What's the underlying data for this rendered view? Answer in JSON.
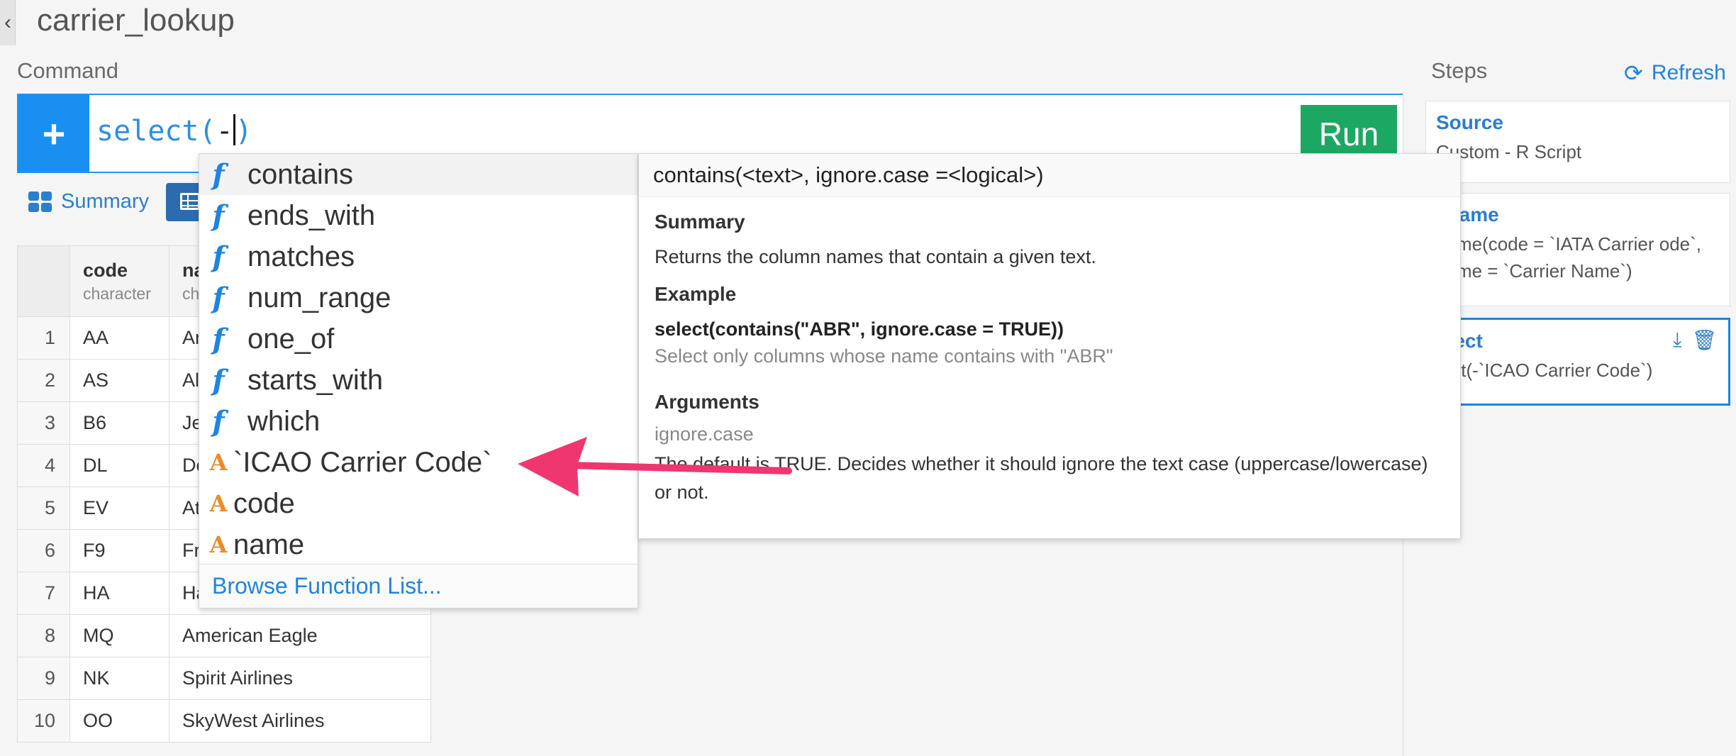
{
  "header": {
    "title": "carrier_lookup",
    "back_icon": "chevron-left-icon"
  },
  "command": {
    "label": "Command",
    "prefix": "select(",
    "typed": "-",
    "suffix": ")",
    "run_label": "Run",
    "add_icon": "plus-icon"
  },
  "view": {
    "summary_label": "Summary",
    "summary_icon": "grid-icon",
    "table_icon": "table-icon"
  },
  "table": {
    "columns": [
      {
        "name": "code",
        "type": "character"
      },
      {
        "name": "na",
        "type": "ch"
      }
    ],
    "rows": [
      [
        "1",
        "AA",
        "Ar"
      ],
      [
        "2",
        "AS",
        "Al"
      ],
      [
        "3",
        "B6",
        "Je"
      ],
      [
        "4",
        "DL",
        "De"
      ],
      [
        "5",
        "EV",
        "At"
      ],
      [
        "6",
        "F9",
        "Fr"
      ],
      [
        "7",
        "HA",
        "Ha"
      ],
      [
        "8",
        "MQ",
        "American Eagle"
      ],
      [
        "9",
        "NK",
        "Spirit Airlines"
      ],
      [
        "10",
        "OO",
        "SkyWest Airlines"
      ]
    ]
  },
  "steps": {
    "label": "Steps",
    "refresh_label": "Refresh",
    "items": [
      {
        "name": "Source",
        "desc": "Custom - R Script"
      },
      {
        "name": "ename",
        "desc": "name(code = `IATA Carrier ode`, name = `Carrier Name`)"
      },
      {
        "name": "elect",
        "desc": "lect(-`ICAO Carrier Code`)"
      }
    ]
  },
  "autocomplete": {
    "functions": [
      "contains",
      "ends_with",
      "matches",
      "num_range",
      "one_of",
      "starts_with",
      "which"
    ],
    "columns": [
      "`ICAO Carrier Code`",
      "code",
      "name"
    ],
    "footer": "Browse Function List..."
  },
  "help": {
    "signature": "contains(<text>, ignore.case =<logical>)",
    "summary_heading": "Summary",
    "summary_text": "Returns the column names that contain a given text.",
    "example_heading": "Example",
    "example_code": "select(contains(\"ABR\", ignore.case = TRUE))",
    "example_desc": "Select only columns whose name contains with \"ABR\"",
    "arguments_heading": "Arguments",
    "arg_name": "ignore.case",
    "arg_desc_1": "The default is TRUE. Decides whether it should ignore the text case (uppercase/lowercase)",
    "arg_desc_2": "or not."
  },
  "colors": {
    "accent": "#1f84e0",
    "run": "#1ca862",
    "annotation_arrow": "#f0366f",
    "column_icon": "#f08a24"
  }
}
